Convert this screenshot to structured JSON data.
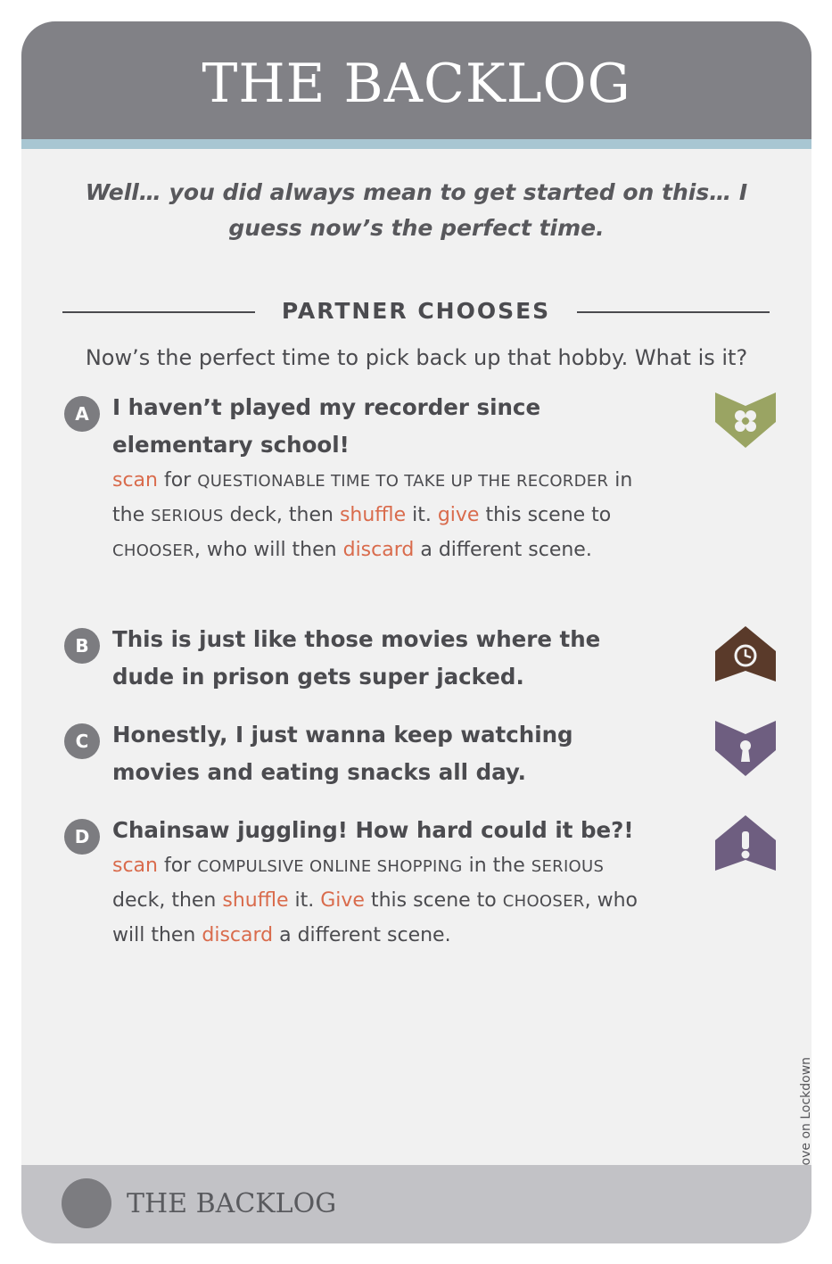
{
  "card": {
    "title": "THE BACKLOG",
    "flavor": "Well… you did always mean to get started on this… I guess now’s the perfect time.",
    "section_label": "PARTNER CHOOSES",
    "prompt": "Now’s the perfect time to pick back up that hobby. What is it?",
    "footer_title": "THE BACKLOG",
    "side_text": "Love on Lockdown"
  },
  "options": [
    {
      "letter": "A",
      "title": "I haven’t played my recorder since elementary school!",
      "icon": "flower-down-icon",
      "rule": {
        "w1": "scan",
        "t1": " for ",
        "sc1": "questionable time to take up the recorder",
        "t2": " in the ",
        "sc2": "serious",
        "t3": " deck, then ",
        "w2": "shuffle",
        "t4": " it. ",
        "w3": "give",
        "t5": " this scene to ",
        "sc3": "chooser",
        "t6": ", who will then ",
        "w4": "discard",
        "t7": " a different scene."
      }
    },
    {
      "letter": "B",
      "title": "This is just like those movies where the dude in prison gets super jacked.",
      "icon": "clock-up-icon"
    },
    {
      "letter": "C",
      "title": "Honestly, I just wanna keep watching movies and eating snacks all day.",
      "icon": "keyhole-down-icon"
    },
    {
      "letter": "D",
      "title": "Chainsaw juggling! How hard could it be?!",
      "icon": "exclamation-up-icon",
      "rule": {
        "w1": "scan",
        "t1": " for ",
        "sc1": "compulsive online shopping",
        "t2": " in the ",
        "sc2": "serious",
        "t3": " deck, then ",
        "w2": "shuffle",
        "t4": " it. ",
        "w3": "Give",
        "t5": " this scene to ",
        "sc3": "chooser",
        "t6": ", who will then ",
        "w4": "discard",
        "t7": " a different scene."
      }
    }
  ],
  "colors": {
    "header": "#818186",
    "stripe": "#a8c6d2",
    "keyword": "#d96b4c",
    "icon_green": "#9aa463",
    "icon_brown": "#5a3a2a",
    "icon_purple": "#6e5e80"
  }
}
